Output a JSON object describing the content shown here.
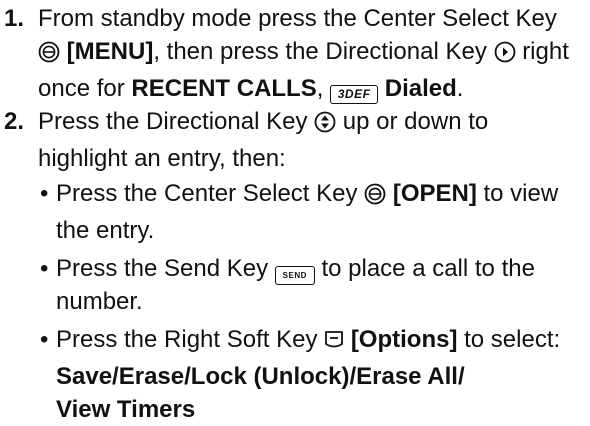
{
  "steps": [
    {
      "number": "1.",
      "t1": "From standby mode press the Center Select Key",
      "t2": "[MENU]",
      "t3": ", then press the Directional Key",
      "t4": "right once for",
      "t5": "RECENT CALLS",
      "t6": ",",
      "t7": "Dialed",
      "t8": "."
    },
    {
      "number": "2.",
      "t1": "Press the Directional Key",
      "t2": "up or down to highlight an entry, then:",
      "bullets": [
        {
          "t1": "Press the Center Select Key",
          "t2": "[OPEN]",
          "t3": "to view the entry."
        },
        {
          "t1": "Press the Send Key",
          "t2": "to place a call to the number."
        },
        {
          "t1": "Press the Right Soft Key",
          "t2": "[Options]",
          "t3": "to select:",
          "options_line1": "Save/Erase/Lock (Unlock)/Erase All/",
          "options_line2": "View Timers"
        }
      ]
    }
  ],
  "keys": {
    "send_label": "SEND",
    "dialed_key_label": "3DEF"
  },
  "bullet_symbol": "•",
  "icons": {
    "center_select": "center-select-key-icon",
    "directional_right": "directional-key-right-icon",
    "directional_updown": "directional-key-updown-icon",
    "right_soft": "right-soft-key-icon",
    "send": "send-key-icon",
    "number_key": "number-3-key-icon"
  }
}
